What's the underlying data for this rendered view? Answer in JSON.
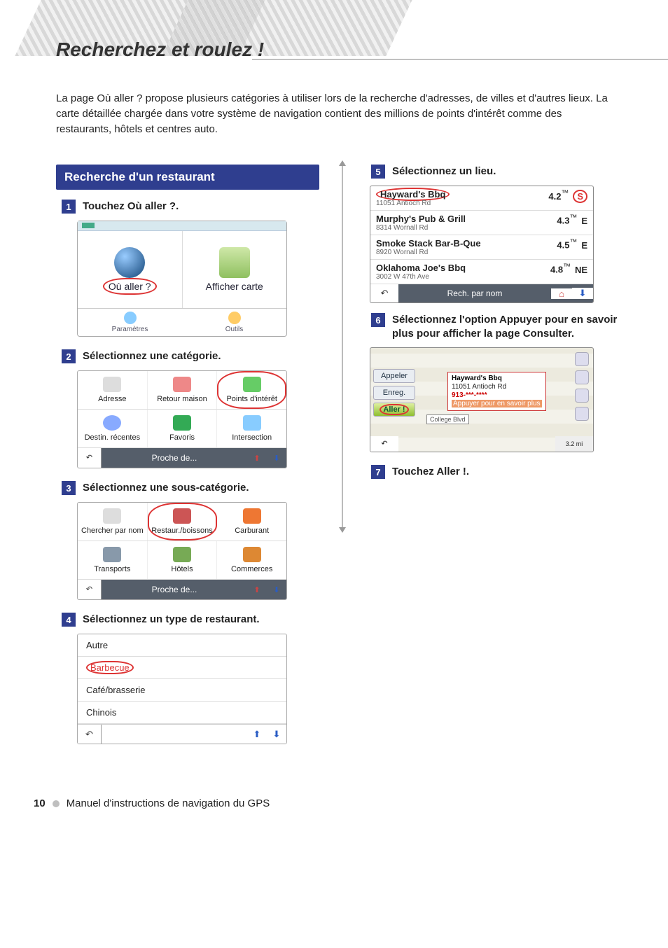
{
  "page_title": "Recherchez et roulez !",
  "intro": "La page Où aller ? propose plusieurs catégories à utiliser lors de la recherche d'adresses, de villes et d'autres lieux. La carte détaillée chargée dans votre système de navigation contient des millions de points d'intérêt comme des restaurants, hôtels et centres auto.",
  "section_title": "Recherche d'un restaurant",
  "steps": {
    "s1": {
      "num": "1",
      "text": "Touchez Où aller ?."
    },
    "s2": {
      "num": "2",
      "text": "Sélectionnez une catégorie."
    },
    "s3": {
      "num": "3",
      "text": "Sélectionnez une sous-catégorie."
    },
    "s4": {
      "num": "4",
      "text": "Sélectionnez un type de restaurant."
    },
    "s5": {
      "num": "5",
      "text": "Sélectionnez un lieu."
    },
    "s6": {
      "num": "6",
      "text": "Sélectionnez l'option Appuyer pour en savoir plus pour afficher la page Consulter."
    },
    "s7": {
      "num": "7",
      "text": "Touchez Aller !."
    }
  },
  "home_screen": {
    "where_to": "Où aller ?",
    "view_map": "Afficher carte",
    "settings": "Paramètres",
    "tools": "Outils"
  },
  "cat_screen": {
    "items": [
      {
        "label": "Adresse"
      },
      {
        "label": "Retour maison"
      },
      {
        "label": "Points d'intérêt"
      },
      {
        "label": "Destin. récentes"
      },
      {
        "label": "Favoris"
      },
      {
        "label": "Intersection"
      }
    ],
    "bottom": "Proche de..."
  },
  "subcat_screen": {
    "items": [
      {
        "label": "Chercher par nom"
      },
      {
        "label": "Restaur./boissons"
      },
      {
        "label": "Carburant"
      },
      {
        "label": "Transports"
      },
      {
        "label": "Hôtels"
      },
      {
        "label": "Commerces"
      }
    ],
    "bottom": "Proche de..."
  },
  "type_screen": {
    "items": [
      {
        "label": "Autre"
      },
      {
        "label": "Barbecue"
      },
      {
        "label": "Café/brasserie"
      },
      {
        "label": "Chinois"
      }
    ]
  },
  "results_screen": {
    "rows": [
      {
        "name": "Hayward's Bbq",
        "addr": "11051 Antioch Rd",
        "dist": "4.2",
        "unit": "™",
        "dir": "S"
      },
      {
        "name": "Murphy's Pub & Grill",
        "addr": "8314 Wornall Rd",
        "dist": "4.3",
        "unit": "™",
        "dir": "E"
      },
      {
        "name": "Smoke Stack Bar-B-Que",
        "addr": "8920 Wornall Rd",
        "dist": "4.5",
        "unit": "™",
        "dir": "E"
      },
      {
        "name": "Oklahoma Joe's Bbq",
        "addr": "3002 W 47th Ave",
        "dist": "4.8",
        "unit": "™",
        "dir": "NE"
      }
    ],
    "bottom": "Rech. par nom"
  },
  "map_screen": {
    "call": "Appeler",
    "save": "Enreg.",
    "go": "Aller !",
    "callout_name": "Hayward's Bbq",
    "callout_addr": "11051 Antioch Rd",
    "callout_phone": "913-***-****",
    "callout_more": "Appuyer pour en savoir plus",
    "street": "College Blvd",
    "scale": "3.2 mi"
  },
  "footer": {
    "page_num": "10",
    "manual": "Manuel d'instructions de navigation du GPS"
  },
  "glyphs": {
    "back": "↶",
    "up": "⬆",
    "down": "⬇",
    "home": "⌂"
  }
}
